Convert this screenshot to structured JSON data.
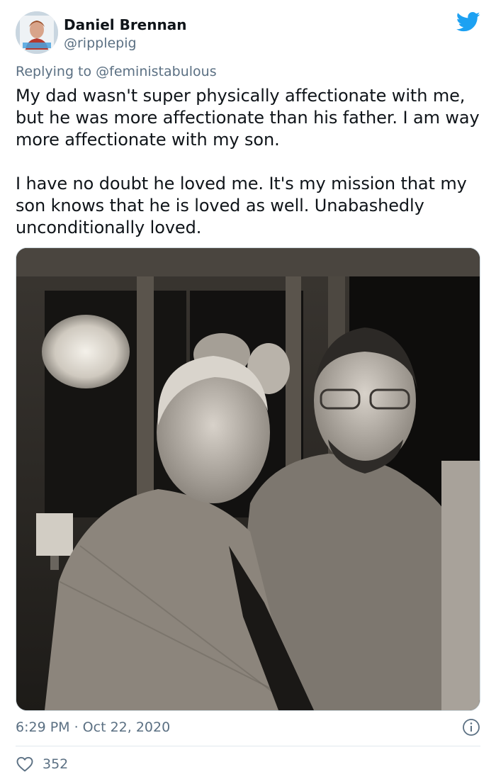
{
  "author": {
    "display_name": "Daniel Brennan",
    "handle": "@ripplepig",
    "avatar_icon": "profile-photo"
  },
  "reply": {
    "prefix": "Replying to",
    "mention": "@feministabulous"
  },
  "tweet": {
    "paragraphs": [
      "My dad wasn't super physically affectionate with me, but he was more affectionate than his father. I am way more affectionate with my son.",
      "I have no doubt he loved me. It's my mission that my son knows that he is loved as well. Unabashedly unconditionally loved."
    ],
    "timestamp": "6:29 PM · Oct 22, 2020"
  },
  "engagement": {
    "likes": "352"
  },
  "colors": {
    "twitter_blue": "#1da1f2",
    "secondary_text": "#5b7083",
    "primary_text": "#0f1419",
    "divider": "#e1e8ed"
  }
}
